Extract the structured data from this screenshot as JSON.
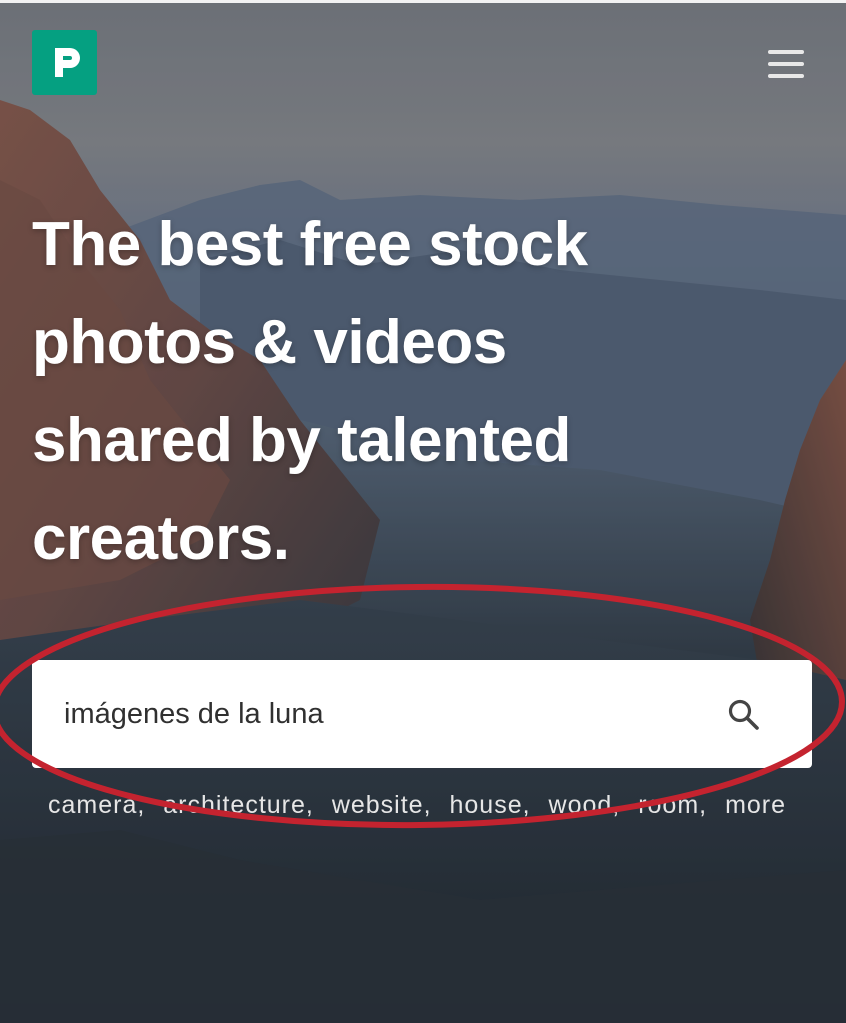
{
  "header": {
    "logo_icon": "pexels-logo-icon",
    "logo_color": "#05a081",
    "menu_icon": "hamburger-menu-icon"
  },
  "hero": {
    "headline_lines": [
      "The best free stock",
      "photos & videos",
      "shared by talented",
      "creators."
    ]
  },
  "search": {
    "value": "imágenes de la luna",
    "icon": "search-icon"
  },
  "suggestions": {
    "tags": [
      "camera",
      "architecture",
      "website",
      "house",
      "wood",
      "room",
      "more"
    ]
  },
  "annotation": {
    "shape": "ellipse",
    "color": "#c4232f",
    "target": "search-box"
  }
}
